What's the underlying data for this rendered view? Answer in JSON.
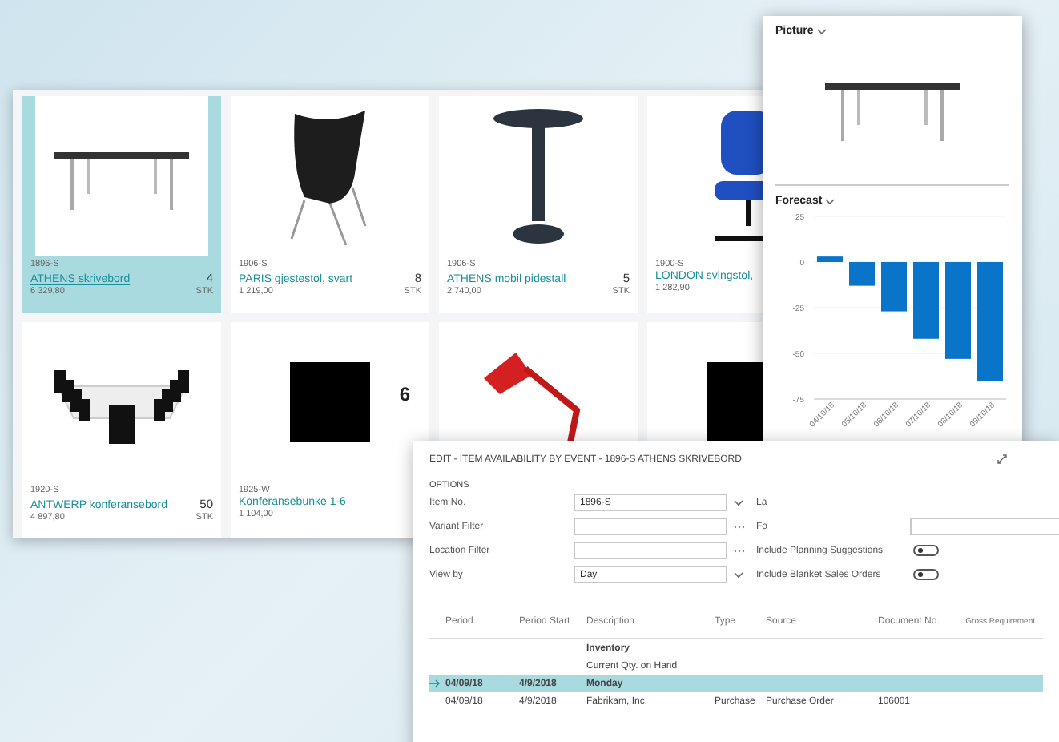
{
  "items_window": {
    "tiles": [
      {
        "code": "1896-S",
        "name": "ATHENS skrivebord",
        "count": "4",
        "price": "6 329,80",
        "unit": "STK",
        "selected": true
      },
      {
        "code": "1906-S",
        "name": "PARIS gjestestol, svart",
        "count": "8",
        "price": "1 219,00",
        "unit": "STK",
        "selected": false
      },
      {
        "code": "1906-S",
        "name": "ATHENS mobil pidestall",
        "count": "5",
        "price": "2 740,00",
        "unit": "STK",
        "selected": false
      },
      {
        "code": "1900-S",
        "name": "LONDON svingstol,",
        "price": "1 282,90",
        "selected": false
      },
      {
        "code": "1920-S",
        "name": "ANTWERP konferansebord",
        "count": "50",
        "price": "4 897,80",
        "unit": "STK",
        "selected": false
      },
      {
        "code": "1925-W",
        "name": "Konferansebunke 1-6",
        "price": "1 104,00",
        "selected": false,
        "bundle_count": "6"
      },
      {
        "selected": false
      },
      {
        "selected": false
      }
    ]
  },
  "factbox": {
    "picture_title": "Picture",
    "forecast_title": "Forecast",
    "chart_data": {
      "type": "bar",
      "categories": [
        "04/10/18",
        "05/10/18",
        "06/10/18",
        "07/10/18",
        "08/10/18",
        "09/10/18"
      ],
      "series": [
        {
          "color": "#0a74c8",
          "values": [
            3,
            -13,
            -27,
            -42,
            -53,
            -65
          ]
        }
      ],
      "ylim": [
        -75,
        25
      ],
      "yticks": [
        25,
        0,
        -25,
        -50,
        -75
      ],
      "grid": true
    }
  },
  "dialog": {
    "title": "EDIT - ITEM AVAILABILITY BY EVENT - 1896-S ATHENS SKRIVEBORD",
    "section": "OPTIONS",
    "left_fields": [
      {
        "label": "Item No.",
        "value": "1896-S",
        "kind": "dropdown"
      },
      {
        "label": "Variant Filter",
        "kind": "lookup"
      },
      {
        "label": "Location Filter",
        "kind": "lookup"
      },
      {
        "label": "View by",
        "value": "Day",
        "kind": "select"
      }
    ],
    "right_fields": [
      {
        "label": "La",
        "kind": "text"
      },
      {
        "label": "Fo",
        "kind": "dropdown"
      },
      {
        "label": "Include Planning Suggestions",
        "kind": "toggle",
        "on": false
      },
      {
        "label": "Include Blanket Sales Orders",
        "kind": "toggle",
        "on": false
      }
    ],
    "table": {
      "columns": [
        "Period",
        "Period Start",
        "Description",
        "Type",
        "Source",
        "Document No.",
        "Gross Requirement"
      ],
      "rows": [
        {
          "cells": [
            "",
            "",
            "Inventory",
            "",
            "",
            "",
            ""
          ],
          "bold": true,
          "selected": false
        },
        {
          "cells": [
            "",
            "",
            "Current Qty. on Hand",
            "",
            "",
            "",
            ""
          ],
          "bold": false,
          "selected": false
        },
        {
          "cells": [
            "04/09/18",
            "4/9/2018",
            "Monday",
            "",
            "",
            "",
            ""
          ],
          "bold": true,
          "selected": true
        },
        {
          "cells": [
            "04/09/18",
            "4/9/2018",
            "Fabrikam, Inc.",
            "Purchase",
            "Purchase Order",
            "106001",
            ""
          ],
          "bold": false,
          "selected": false
        }
      ]
    }
  }
}
